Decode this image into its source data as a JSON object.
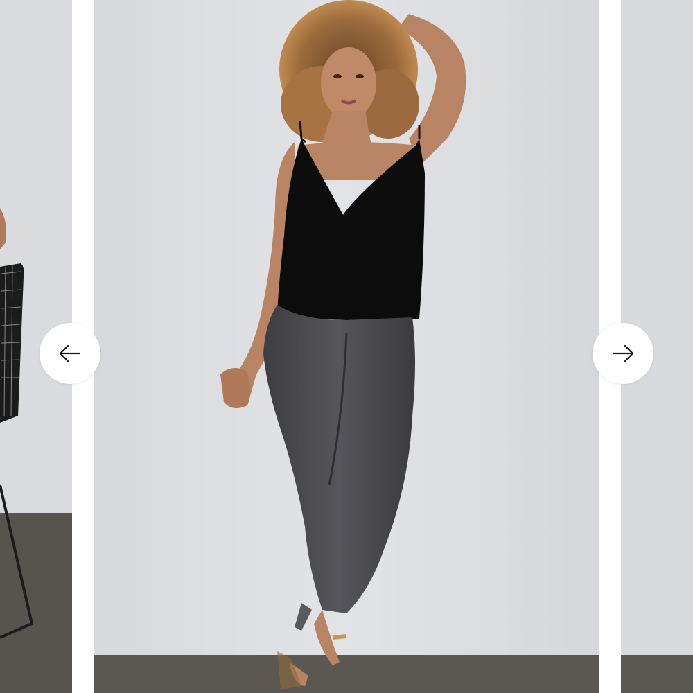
{
  "carousel": {
    "prev_button_label": "Previous",
    "next_button_label": "Next",
    "slides": [
      {
        "image": "model-seated-on-wire-chair"
      },
      {
        "image": "model-black-velvet-cami-grey-skinny-jeans",
        "active": true
      },
      {
        "image": "next-product-photo"
      }
    ],
    "colors": {
      "backdrop": "#dcdde0",
      "floor": "#55534f",
      "button_bg": "#ffffff",
      "arrow": "#1a1a1a"
    }
  }
}
